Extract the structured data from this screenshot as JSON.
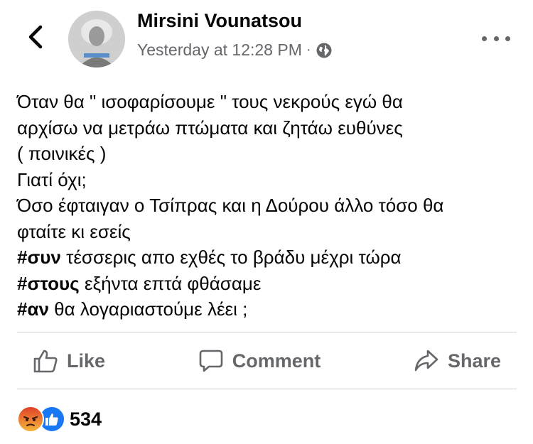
{
  "header": {
    "author": "Mirsini Vounatsou",
    "timestamp": "Yesterday at 12:28 PM",
    "separator": "·",
    "privacy_icon": "globe-icon",
    "back_icon": "chevron-left-icon",
    "more_icon": "more-horizontal-icon"
  },
  "post": {
    "lines": [
      {
        "text": "Όταν θα \" ισοφαρίσουμε \" τους νεκρούς εγώ θα"
      },
      {
        "text": "αρχίσω να μετράω πτώματα και ζητάω ευθύνες"
      },
      {
        "text": "( ποινικές )"
      },
      {
        "text": "Γιατί όχι;"
      },
      {
        "text": "Όσο έφταιγαν ο Τσίπρας και η Δούρου άλλο τόσο θα"
      },
      {
        "text": "φταίτε κι εσείς"
      },
      {
        "tag": "#συν",
        "text": " τέσσερις απο εχθές το βράδυ μέχρι τώρα"
      },
      {
        "tag": "#στους",
        "text": " εξήντα επτά φθάσαμε"
      },
      {
        "tag": "#αν",
        "text": " θα λογαριαστούμε λέει ;"
      }
    ]
  },
  "actions": {
    "like": {
      "label": "Like",
      "icon": "thumbs-up-icon"
    },
    "comment": {
      "label": "Comment",
      "icon": "comment-icon"
    },
    "share": {
      "label": "Share",
      "icon": "share-icon"
    }
  },
  "reactions": {
    "icons": [
      "angry-reaction-icon",
      "like-reaction-icon"
    ],
    "count": "534"
  },
  "colors": {
    "text": "#050505",
    "secondary": "#65676b",
    "like_blue": "#1877f2",
    "angry_orange": "#f0862e"
  }
}
